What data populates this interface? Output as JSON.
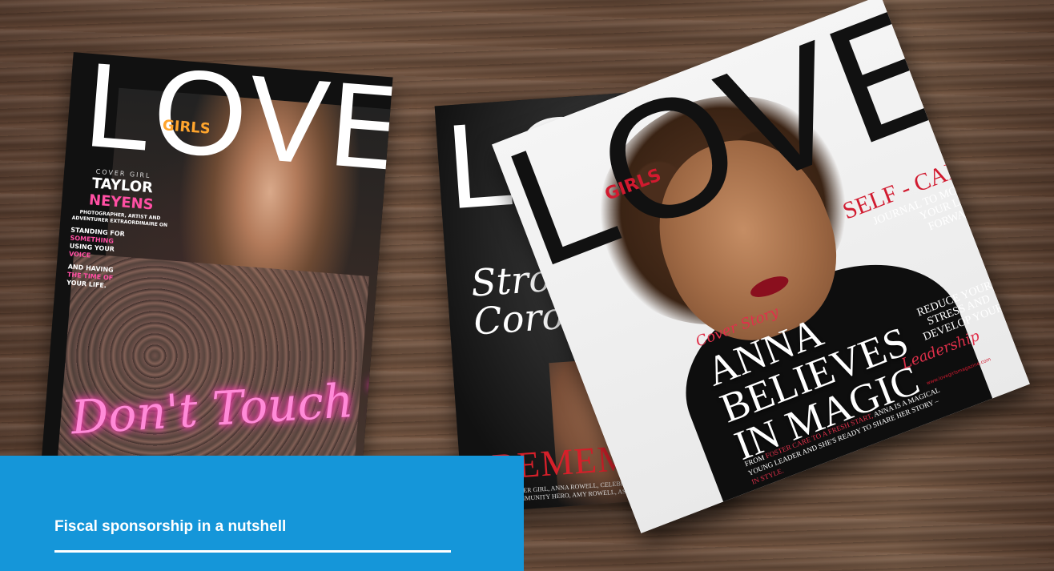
{
  "magazines": [
    {
      "masthead": "LOVE",
      "sub_masthead": "GIRLS",
      "cover_label": "COVER GIRL",
      "name_first": "TAYLOR",
      "name_last": "NEYENS",
      "subtitle": "PHOTOGRAPHER, ARTIST AND ADVENTURER EXTRAORDINAIRE ON",
      "lines": [
        "STANDING FOR",
        "SOMETHING",
        "USING YOUR",
        "VOICE",
        "AND HAVING",
        "THE TIME OF",
        "YOUR LIFE."
      ],
      "script": "Don't Touch The Art"
    },
    {
      "masthead": "LO",
      "script": "Strong that Corona",
      "headline": "REMEMBE",
      "small_text": "COVER GIRL, ANNA ROWELL, CELEBRATES THE LIFE OF HER COMMUNITY HERO, AMY ROWELL, AS WE CELEBRATE THEM"
    },
    {
      "masthead": "LOVE",
      "sub_masthead": "GIRLS",
      "cover_story": "Cover Story",
      "headline_1": "ANNA",
      "headline_2": "BELIEVES",
      "headline_3": "IN MAGIC",
      "from_text_1": "FROM",
      "from_text_red": "FOSTER CARE TO A FRESH START,",
      "from_text_2": "ANNA IS A MAGICAL YOUNG LEADER AND SHE'S READY TO SHARE HER STORY –",
      "from_text_red_2": "IN STYLE.",
      "selfcare": "SELF - CARE:",
      "journal": "JOURNAL TO MOVE YOUR LIFE FORWARD",
      "reduce": "REDUCE YOUR STRESS AND DEVELOP YOUR",
      "leadership": "Leadership",
      "site": "www.lovegirlsmagazine.com"
    }
  ],
  "caption": {
    "title": "Fiscal sponsorship in a nutshell"
  },
  "colors": {
    "accent_blue": "#1596d9",
    "neon_pink": "#ff4fa3",
    "magazine_red": "#d11a2f"
  }
}
